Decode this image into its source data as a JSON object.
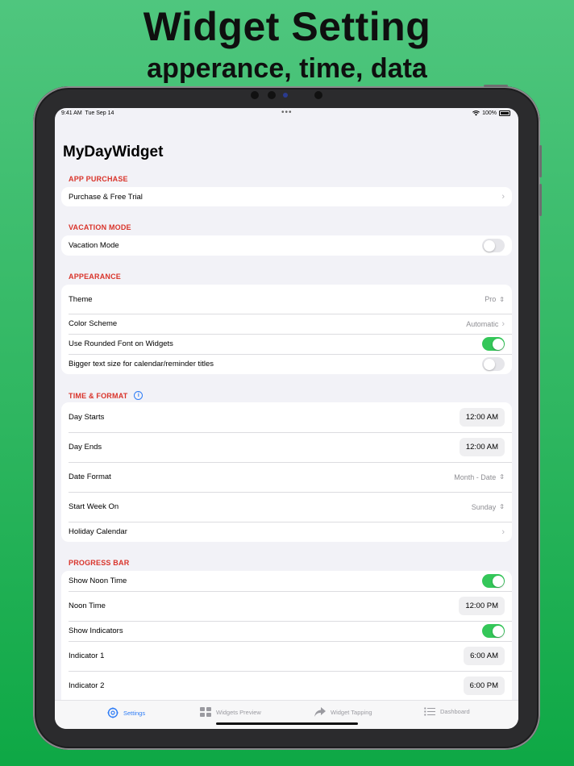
{
  "headline": {
    "title": "Widget Setting",
    "subtitle": "apperance, time, data"
  },
  "status_bar": {
    "time": "9:41 AM",
    "date": "Tue Sep 14",
    "battery": "100%",
    "multitask_dots": "•••"
  },
  "app": {
    "title": "MyDayWidget",
    "accent_color": "#d9342b",
    "toggle_on_color": "#34c759"
  },
  "sections": {
    "app_purchase": {
      "header": "APP PURCHASE",
      "purchase_row": {
        "label": "Purchase & Free Trial"
      }
    },
    "vacation_mode": {
      "header": "VACATION MODE",
      "vacation_row": {
        "label": "Vacation Mode",
        "enabled": false
      }
    },
    "appearance": {
      "header": "APPEARANCE",
      "theme": {
        "label": "Theme",
        "value": "Pro"
      },
      "color_scheme": {
        "label": "Color Scheme",
        "value": "Automatic"
      },
      "rounded_font": {
        "label": "Use Rounded Font on Widgets",
        "enabled": true
      },
      "bigger_text": {
        "label": "Bigger text size for calendar/reminder titles",
        "enabled": false
      }
    },
    "time_format": {
      "header": "TIME & FORMAT",
      "day_starts": {
        "label": "Day Starts",
        "value": "12:00 AM"
      },
      "day_ends": {
        "label": "Day Ends",
        "value": "12:00 AM"
      },
      "date_format": {
        "label": "Date Format",
        "value": "Month - Date"
      },
      "start_week": {
        "label": "Start Week On",
        "value": "Sunday"
      },
      "holiday_calendar": {
        "label": "Holiday Calendar"
      }
    },
    "progress_bar": {
      "header": "PROGRESS BAR",
      "show_noon": {
        "label": "Show Noon Time",
        "enabled": true
      },
      "noon_time": {
        "label": "Noon Time",
        "value": "12:00 PM"
      },
      "show_indicators": {
        "label": "Show Indicators",
        "enabled": true
      },
      "indicator1": {
        "label": "Indicator 1",
        "value": "6:00 AM"
      },
      "indicator2": {
        "label": "Indicator 2",
        "value": "6:00 PM"
      }
    }
  },
  "tabs": [
    {
      "label": "Settings",
      "icon": "gear-icon",
      "active": true
    },
    {
      "label": "Widgets Preview",
      "icon": "grid-icon",
      "active": false
    },
    {
      "label": "Widget Tapping",
      "icon": "share-arrow-icon",
      "active": false
    },
    {
      "label": "Dashboard",
      "icon": "list-icon",
      "active": false
    }
  ]
}
